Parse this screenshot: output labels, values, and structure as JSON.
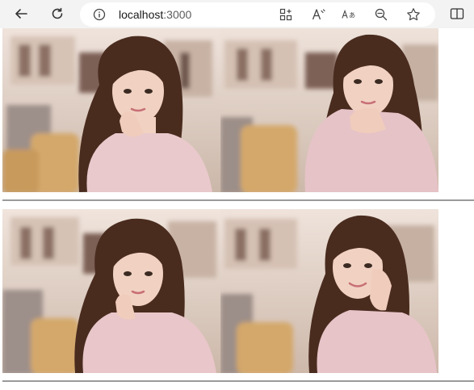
{
  "browser": {
    "url_host": "localhost",
    "url_port": ":3000",
    "icons": {
      "back": "back-arrow-icon",
      "refresh": "refresh-icon",
      "info": "info-icon",
      "apps": "app-available-icon",
      "read_aloud": "read-aloud-icon",
      "translate": "translate-icon",
      "zoom": "zoom-out-icon",
      "favorite": "favorite-star-icon",
      "split": "split-screen-icon"
    }
  },
  "gallery": {
    "rows": [
      {
        "photos": [
          {
            "pose": "chin-rest-right-hand-front",
            "shirt": "#e9c9cc"
          },
          {
            "pose": "chin-rest-looking-up-side",
            "shirt": "#e6c3c7"
          }
        ]
      },
      {
        "photos": [
          {
            "pose": "hand-at-chin-facing-front",
            "shirt": "#e8c6c9"
          },
          {
            "pose": "hand-at-cheek-smiling",
            "shirt": "#e7c4c8"
          }
        ]
      }
    ],
    "colors": {
      "background_blur": "#e8d9cf",
      "hair": "#4a2c1f",
      "skin": "#f1d2c2",
      "chair": "#d4a86a",
      "divider": "#9a9a9a"
    }
  }
}
